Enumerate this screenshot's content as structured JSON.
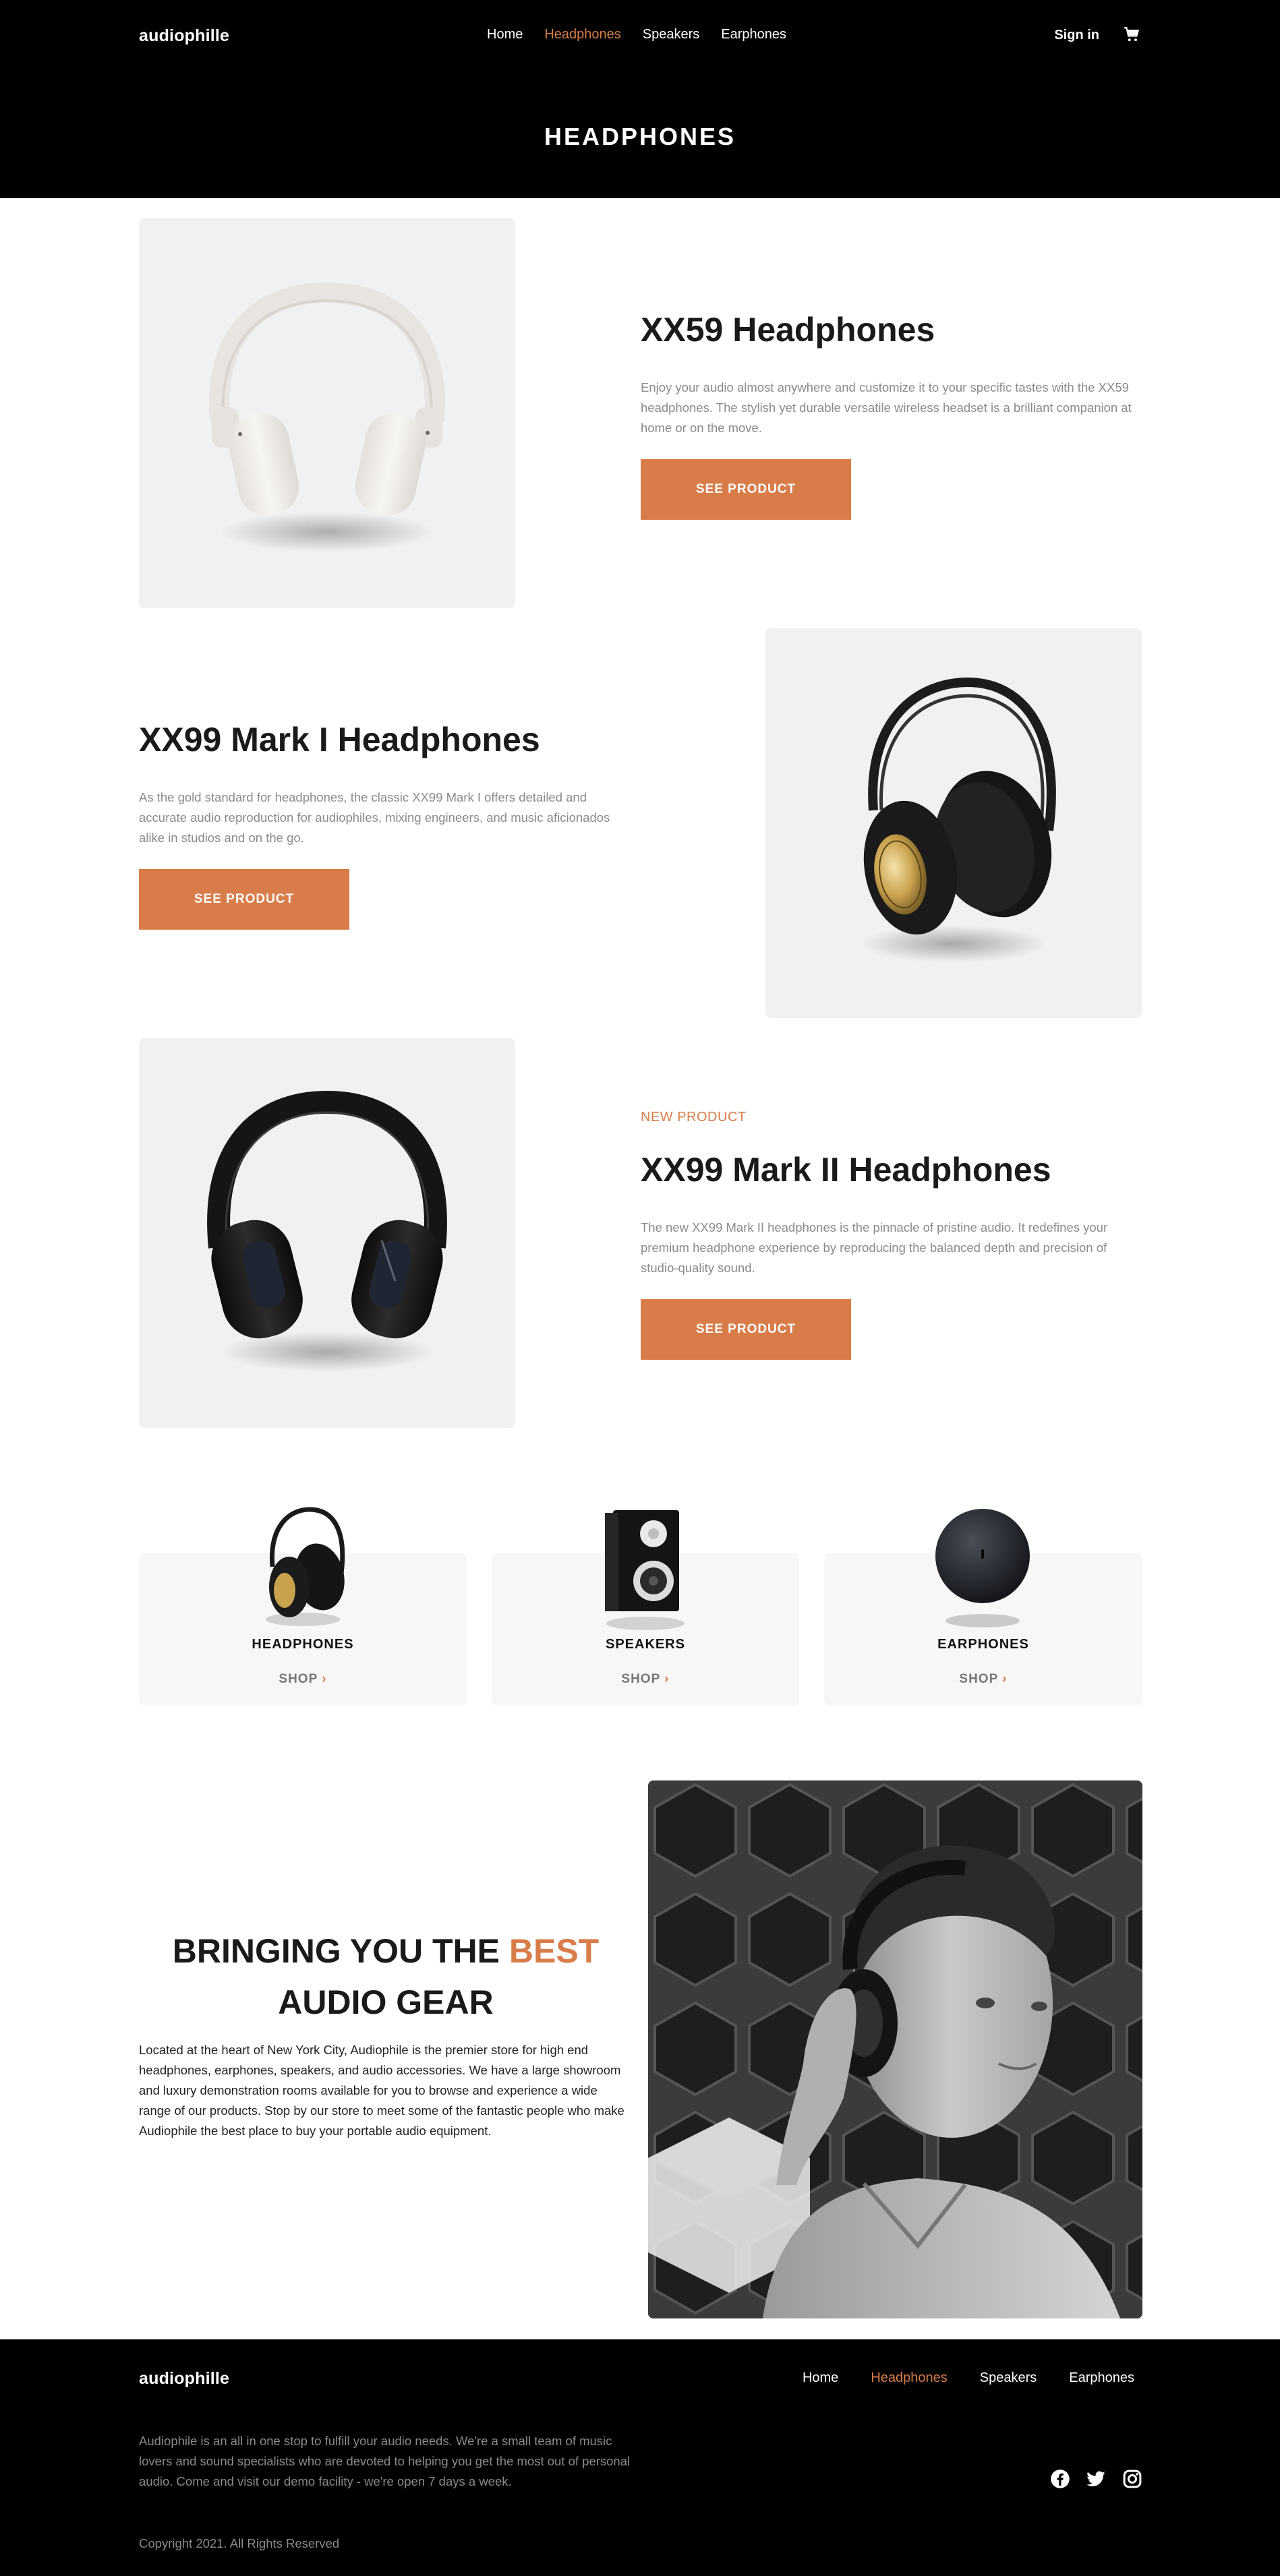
{
  "header": {
    "logo": "audiophille",
    "nav": [
      "Home",
      "Headphones",
      "Speakers",
      "Earphones"
    ],
    "active_nav": "Headphones",
    "sign_in": "Sign in",
    "cart_icon": "cart-icon"
  },
  "page_title": "HEADPHONES",
  "products": [
    {
      "name": "XX59 Headphones",
      "description": "Enjoy your audio almost anywhere and customize it to your specific tastes with the XX59 headphones. The stylish yet durable versatile wireless headset is a brilliant companion at home or on the move.",
      "button": "SEE PRODUCT"
    },
    {
      "name": "XX99 Mark I Headphones",
      "description": "As the gold standard for headphones, the classic XX99 Mark I offers detailed and accurate audio reproduction for audiophiles, mixing engineers, and music aficionados alike in studios and on the go.",
      "button": "SEE PRODUCT"
    },
    {
      "overline": "NEW PRODUCT",
      "name": "XX99 Mark II Headphones",
      "description": "The new XX99 Mark II headphones is the pinnacle of pristine audio. It redefines your premium headphone experience by reproducing the balanced depth and precision of studio-quality sound.",
      "button": "SEE PRODUCT"
    }
  ],
  "categories": [
    {
      "name": "HEADPHONES",
      "link": "SHOP"
    },
    {
      "name": "SPEAKERS",
      "link": "SHOP"
    },
    {
      "name": "EARPHONES",
      "link": "SHOP"
    }
  ],
  "about": {
    "heading_part1": "BRINGING YOU THE ",
    "heading_accent": "BEST",
    "heading_part2": "AUDIO GEAR",
    "text": "Located at the heart of New York City, Audiophile is the premier store for high end headphones, earphones, speakers, and audio accessories. We have a large showroom and luxury demonstration rooms available for you to browse and experience a wide range of our products. Stop by our store to meet some of the fantastic people who make Audiophile the best place to buy your portable audio equipment."
  },
  "footer": {
    "logo": "audiophille",
    "nav": [
      "Home",
      "Headphones",
      "Speakers",
      "Earphones"
    ],
    "active_nav": "Headphones",
    "text": "Audiophile is an all in one stop to fulfill your audio needs. We're a small team of music lovers and sound specialists who are devoted to helping you get the most out of personal audio. Come and visit our demo facility - we're open 7 days a week.",
    "copyright": "Copyright 2021. All Rights Reserved",
    "social_icons": [
      "facebook-icon",
      "twitter-icon",
      "instagram-icon"
    ]
  },
  "colors": {
    "accent": "#d87d4a",
    "dark": "#000000",
    "light_gray": "#f1f1f1",
    "text_gray": "#8a8a8a"
  }
}
